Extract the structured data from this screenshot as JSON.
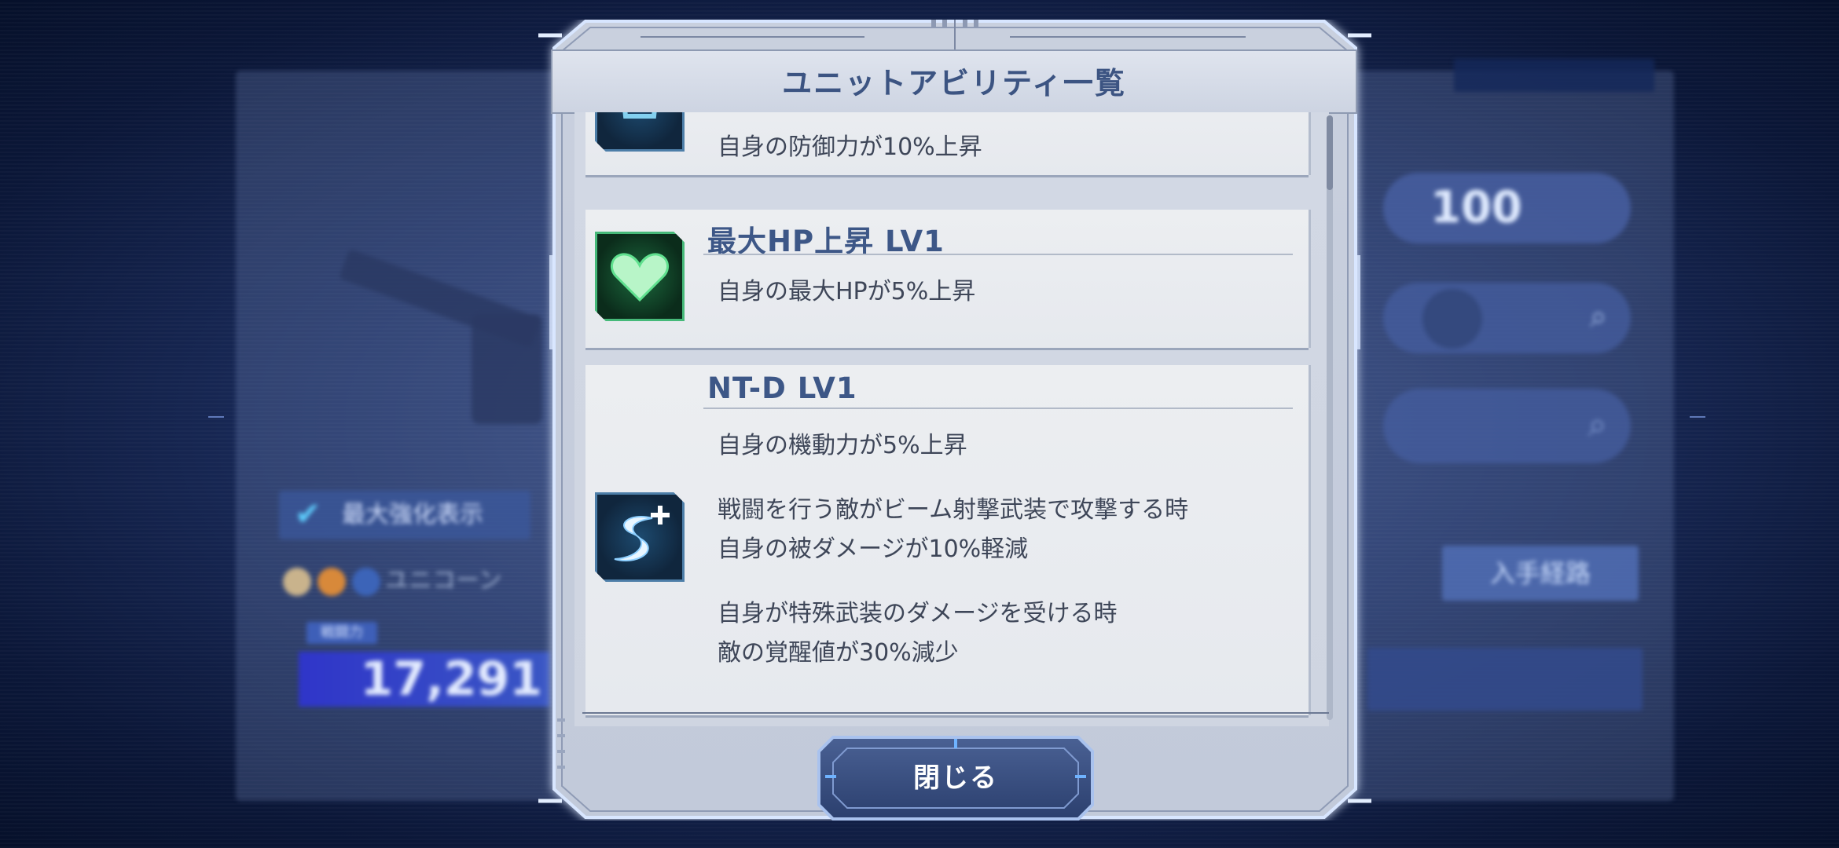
{
  "dialog": {
    "title": "ユニットアビリティ一覧",
    "close_label": "閉じる"
  },
  "abilities": [
    {
      "name": "",
      "icon": "shield-icon",
      "description_lines": [
        "自身の防御力が10%上昇"
      ]
    },
    {
      "name": "最大HP上昇 LV1",
      "icon": "heart-icon",
      "description_lines": [
        "自身の最大HPが5%上昇"
      ]
    },
    {
      "name": "NT-D LV1",
      "icon": "ntd-plus-icon",
      "description_lines": [
        "自身の機動力が5%上昇",
        "戦闘を行う敵がビーム射撃武装で攻撃する時",
        "自身の被ダメージが10%軽減",
        "自身が特殊武装のダメージを受ける時",
        "敵の覚醒値が30%減少"
      ]
    }
  ],
  "background": {
    "max_enhance_label": "最大強化表示",
    "unit_label": "ユニコーン",
    "power_label": "戦闘力",
    "power_value": "17,291",
    "level_value": "100",
    "obtain_label": "入手経路"
  },
  "colors": {
    "title_text": "#3c5482",
    "ability_name": "#3d5787",
    "frame_glow": "#bcd4ff",
    "background": "#1b2c5c"
  }
}
